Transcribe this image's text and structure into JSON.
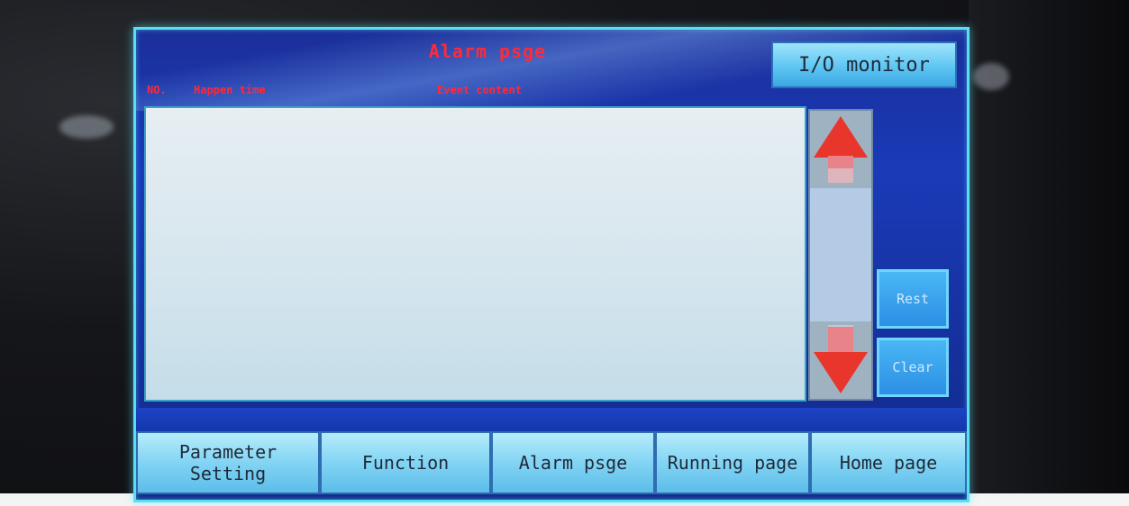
{
  "screen": {
    "title": "Alarm psge",
    "io_monitor_label": "I/O monitor",
    "columns": {
      "no": "NO.",
      "happen_time": "Happen time",
      "event_content": "Event content"
    },
    "side_buttons": {
      "rest": "Rest",
      "clear": "Clear"
    },
    "nav": [
      {
        "label": "Parameter\nSetting"
      },
      {
        "label": "Function"
      },
      {
        "label": "Alarm psge"
      },
      {
        "label": "Running page"
      },
      {
        "label": "Home page"
      }
    ]
  },
  "icons": {
    "scroll_up": "arrow-up-icon",
    "scroll_down": "arrow-down-icon"
  },
  "colors": {
    "title_text": "#ff2a3a",
    "screen_border": "#58e0f2",
    "screen_bg": "#1a3ab8",
    "arrow": "#e8362d"
  }
}
